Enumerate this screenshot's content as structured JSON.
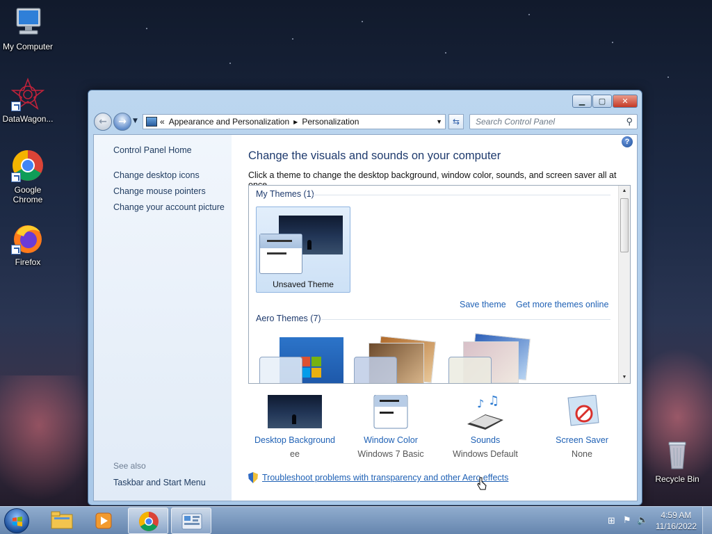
{
  "desktop": {
    "icons": [
      {
        "label": "My Computer",
        "icon": "computer-icon"
      },
      {
        "label": "DataWagon...",
        "icon": "datawagon-icon"
      },
      {
        "label": "Google Chrome",
        "icon": "chrome-icon"
      },
      {
        "label": "Firefox",
        "icon": "firefox-icon"
      },
      {
        "label": "Recycle Bin",
        "icon": "recycle-bin-icon"
      }
    ]
  },
  "window": {
    "breadcrumb": {
      "overflow": "«",
      "items": [
        "Appearance and Personalization",
        "Personalization"
      ]
    },
    "search": {
      "placeholder": "Search Control Panel"
    },
    "left_pane": {
      "home": "Control Panel Home",
      "links": [
        "Change desktop icons",
        "Change mouse pointers",
        "Change your account picture"
      ],
      "see_also_label": "See also",
      "see_also_links": [
        "Taskbar and Start Menu"
      ]
    },
    "main": {
      "headline": "Change the visuals and sounds on your computer",
      "subtext": "Click a theme to change the desktop background, window color, sounds, and screen saver all at once.",
      "my_themes_label": "My Themes (1)",
      "unsaved_theme": "Unsaved Theme",
      "save_theme": "Save theme",
      "more_themes": "Get more themes online",
      "aero_themes_label": "Aero Themes (7)"
    },
    "bottom": [
      {
        "title": "Desktop Background",
        "sub": "ee"
      },
      {
        "title": "Window Color",
        "sub": "Windows 7 Basic"
      },
      {
        "title": "Sounds",
        "sub": "Windows Default"
      },
      {
        "title": "Screen Saver",
        "sub": "None"
      }
    ],
    "troubleshoot": "Troubleshoot problems with transparency and other Aero effects"
  },
  "taskbar": {
    "time": "4:59 AM",
    "date": "11/16/2022"
  },
  "colors": {
    "link": "#1f61b5",
    "heading": "#1e3a6d",
    "taskbar": "#6a8cb6"
  }
}
